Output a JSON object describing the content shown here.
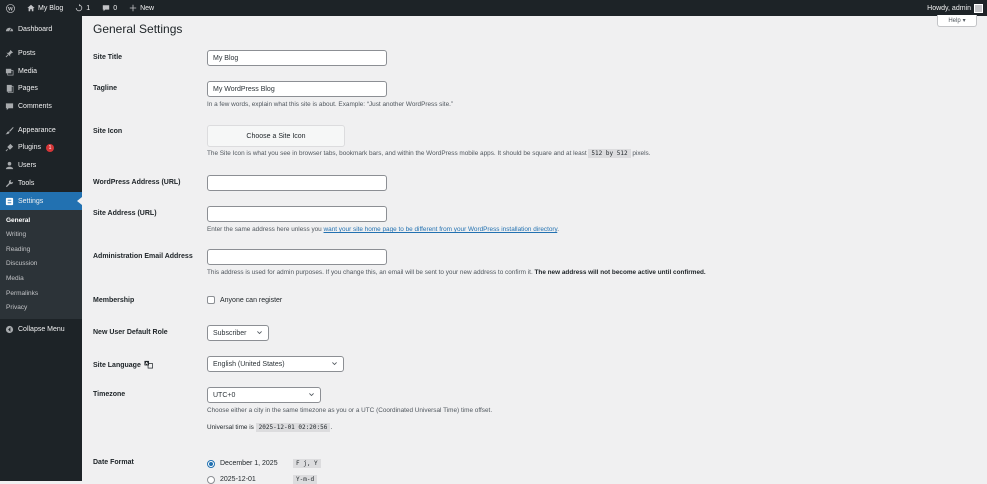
{
  "adminbar": {
    "site_name": "My Blog",
    "updates_count": "1",
    "comments_count": "0",
    "new_label": "New",
    "howdy": "Howdy, admin"
  },
  "sidebar": {
    "items": [
      {
        "label": "Dashboard",
        "icon": "dashboard-icon"
      },
      {
        "label": "Posts",
        "icon": "pin-icon"
      },
      {
        "label": "Media",
        "icon": "media-icon"
      },
      {
        "label": "Pages",
        "icon": "page-icon"
      },
      {
        "label": "Comments",
        "icon": "comment-icon"
      },
      {
        "label": "Appearance",
        "icon": "brush-icon"
      },
      {
        "label": "Plugins",
        "icon": "plug-icon",
        "badge": "1"
      },
      {
        "label": "Users",
        "icon": "user-icon"
      },
      {
        "label": "Tools",
        "icon": "wrench-icon"
      },
      {
        "label": "Settings",
        "icon": "settings-icon"
      }
    ],
    "submenu": [
      "General",
      "Writing",
      "Reading",
      "Discussion",
      "Media",
      "Permalinks",
      "Privacy"
    ],
    "collapse": "Collapse Menu"
  },
  "page": {
    "title": "General Settings",
    "help": "Help"
  },
  "form": {
    "site_title": {
      "label": "Site Title",
      "value": "My Blog"
    },
    "tagline": {
      "label": "Tagline",
      "value": "My WordPress Blog",
      "desc": "In a few words, explain what this site is about. Example: “Just another WordPress site.”"
    },
    "site_icon": {
      "label": "Site Icon",
      "button": "Choose a Site Icon",
      "desc_before": "The Site Icon is what you see in browser tabs, bookmark bars, and within the WordPress mobile apps. It should be square and at least",
      "code1": "512",
      "by": "by",
      "code2": "512",
      "desc_after": "pixels."
    },
    "wp_address": {
      "label": "WordPress Address (URL)",
      "value": ""
    },
    "site_address": {
      "label": "Site Address (URL)",
      "value": "",
      "desc_before": "Enter the same address here unless you",
      "link": "want your site home page to be different from your WordPress installation directory",
      "desc_after": "."
    },
    "admin_email": {
      "label": "Administration Email Address",
      "value": "",
      "desc": "This address is used for admin purposes. If you change this, an email will be sent to your new address to confirm it.",
      "desc_bold": "The new address will not become active until confirmed."
    },
    "membership": {
      "label": "Membership",
      "checkbox": "Anyone can register"
    },
    "default_role": {
      "label": "New User Default Role",
      "value": "Subscriber"
    },
    "language": {
      "label": "Site Language",
      "value": "English (United States)"
    },
    "timezone": {
      "label": "Timezone",
      "value": "UTC+0",
      "desc": "Choose either a city in the same timezone as you or a UTC (Coordinated Universal Time) time offset.",
      "universal_label": "Universal time is",
      "universal_value": "2025-12-01 02:20:56",
      "universal_after": "."
    },
    "date_format": {
      "label": "Date Format",
      "options": [
        {
          "label": "December 1, 2025",
          "code": "F j, Y"
        },
        {
          "label": "2025-12-01",
          "code": "Y-m-d"
        }
      ]
    }
  }
}
